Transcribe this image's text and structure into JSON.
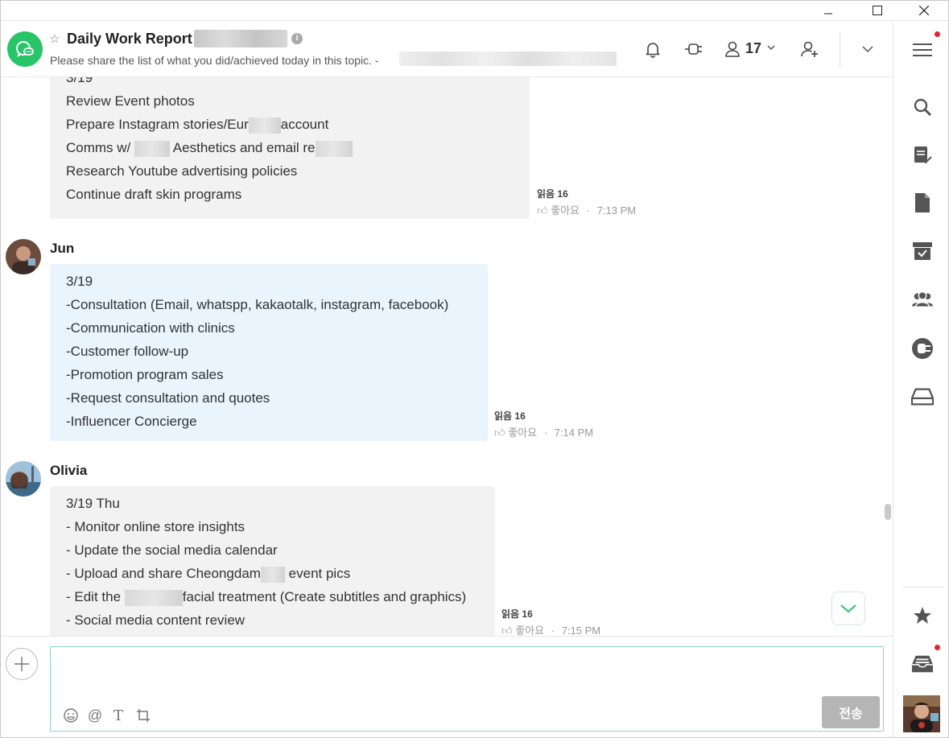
{
  "window": {
    "controls": {
      "minimize": "—",
      "maximize": "☐",
      "close": "✕"
    }
  },
  "header": {
    "title": "Daily Work Report",
    "description": "Please share the list of what you did/achieved today in this topic. -",
    "info_label": "i",
    "member_count": "17",
    "icons": [
      "topic-chat-icon",
      "star-icon",
      "info-icon",
      "bell-icon",
      "connect-plug-icon",
      "members-icon",
      "invite-member-icon",
      "chevron-down-icon"
    ]
  },
  "messages": [
    {
      "sender": "",
      "lines": [
        "3/19",
        "Review Event photos",
        "Prepare Instagram stories/Eur",
        "account",
        "Comms w/ ",
        "Aesthetics and email re",
        "Research Youtube advertising policies",
        "Continue draft skin programs"
      ],
      "read": "읽음 16",
      "like": "좋아요",
      "time": "7:13 PM"
    },
    {
      "sender": "Jun",
      "lines": [
        "3/19",
        "-Consultation (Email, whatspp, kakaotalk, instagram, facebook)",
        "-Communication with clinics",
        "-Customer follow-up",
        "-Promotion program sales",
        "-Request consultation and quotes",
        "-Influencer Concierge"
      ],
      "read": "읽음 16",
      "like": "좋아요",
      "time": "7:14 PM"
    },
    {
      "sender": "Olivia",
      "lines": [
        "3/19 Thu",
        "- Monitor online store insights",
        "- Update the social media calendar",
        "- Upload and share Cheongdam",
        "event pics",
        "- Edit the ",
        "facial treatment (Create subtitles and graphics)",
        "- Social media content review"
      ],
      "read": "읽음 16",
      "like": "좋아요",
      "time": "7:15 PM"
    }
  ],
  "composer": {
    "placeholder": "",
    "send_label": "전송",
    "tools": [
      "emoji-icon",
      "mention-icon",
      "text-format-icon",
      "crop-icon"
    ]
  },
  "sidebar": {
    "icons": [
      "menu-icon",
      "search-icon",
      "todo-icon",
      "file-icon",
      "archive-box-icon",
      "team-icon",
      "connect-icon",
      "inbox-tray-icon",
      "star-icon",
      "notification-tray-icon"
    ]
  },
  "colors": {
    "brand_green": "#27c468",
    "notify_red": "#e8212e",
    "bubble_gray": "#f2f2f2",
    "bubble_blue": "#e9f4fd",
    "send_disabled": "#b5b5b5"
  }
}
